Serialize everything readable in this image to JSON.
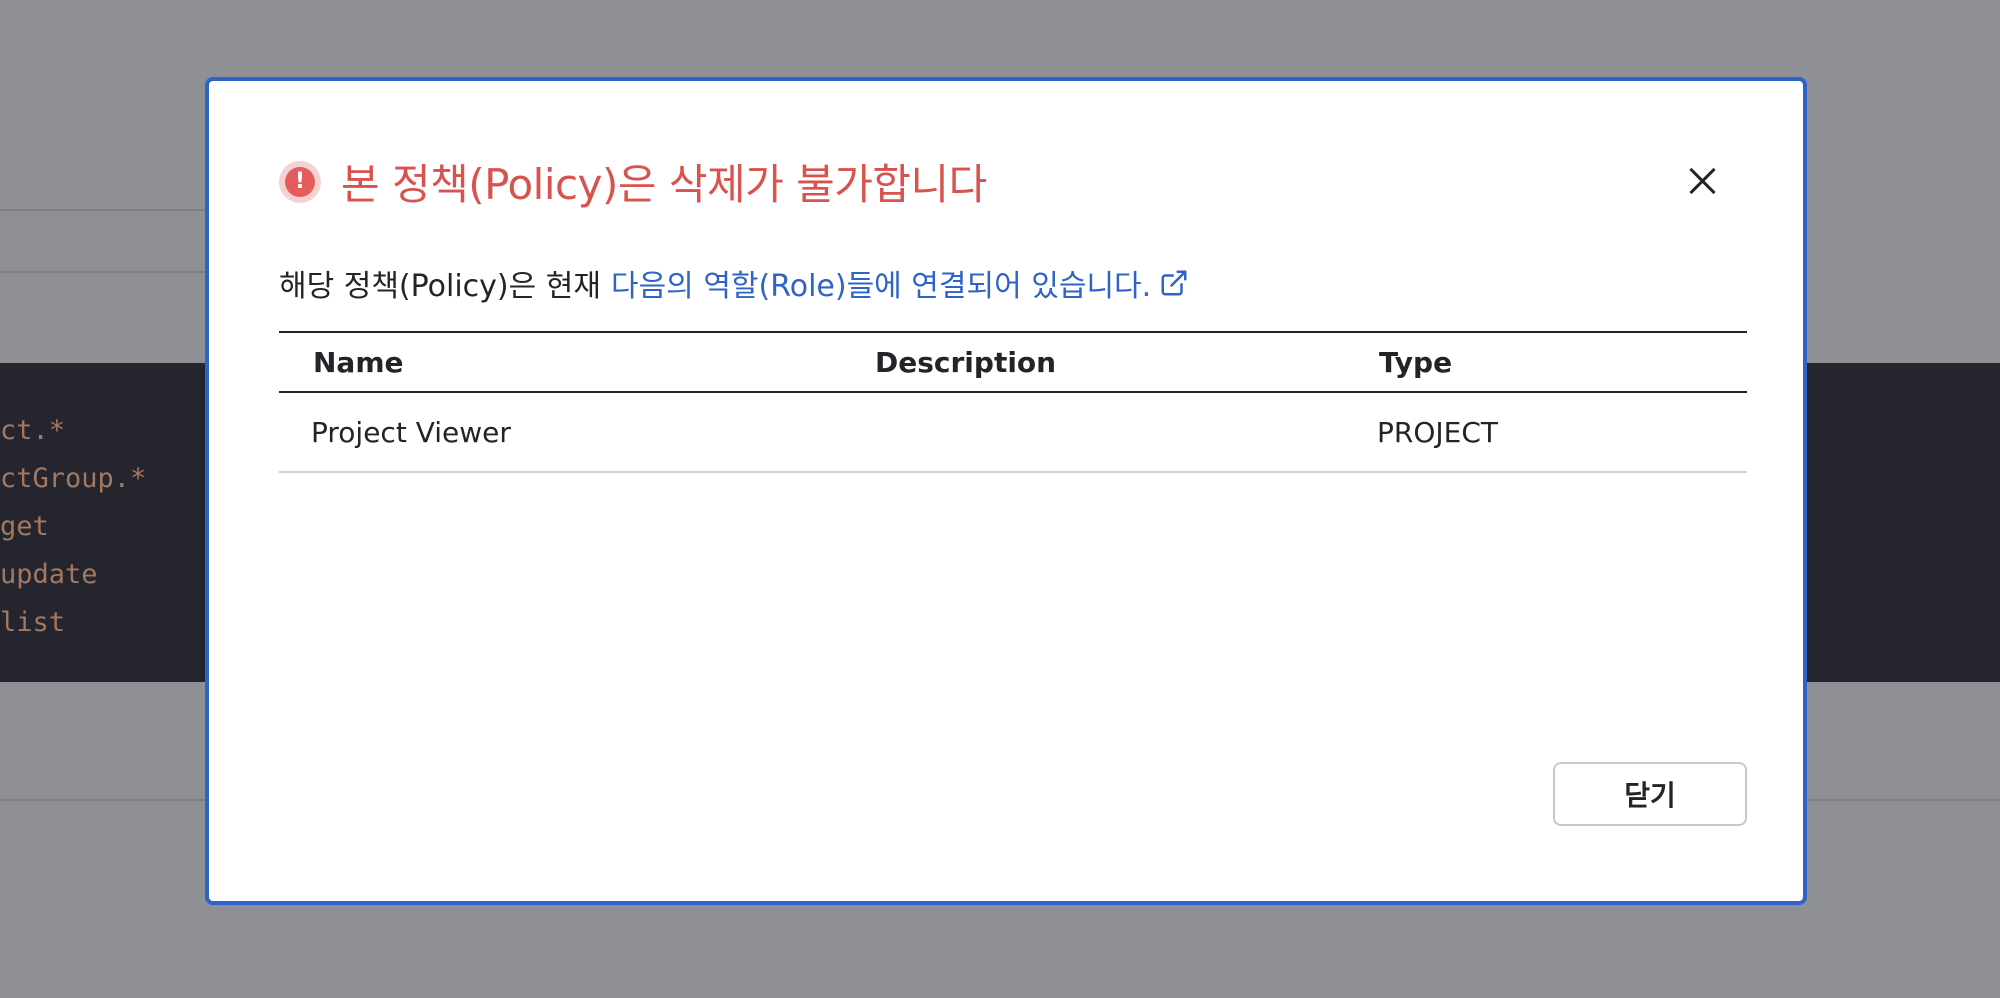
{
  "background": {
    "code_lines": [
      "ct.*",
      "ctGroup.*",
      "get",
      "update",
      "list"
    ]
  },
  "modal": {
    "title": "본 정책(Policy)은 삭제가 불가합니다",
    "alert_icon_glyph": "!",
    "description_prefix": "해당 정책(Policy)은 현재",
    "description_link": "다음의 역할(Role)들에 연결되어 있습니다.",
    "table": {
      "headers": [
        "Name",
        "Description",
        "Type"
      ],
      "rows": [
        {
          "name": "Project Viewer",
          "description": "",
          "type": "PROJECT"
        }
      ]
    },
    "close_button_label": "닫기",
    "colors": {
      "title": "#d8534d",
      "link": "#2f63c7",
      "border": "#2f63c7"
    }
  }
}
